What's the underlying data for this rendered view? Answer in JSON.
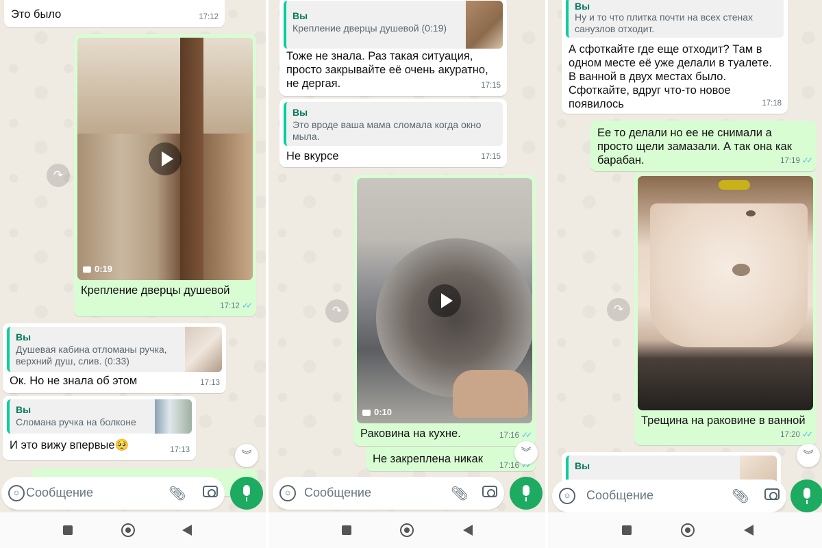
{
  "colors": {
    "chat_bg": "#efeae2",
    "incoming": "#ffffff",
    "outgoing": "#d9fdd3",
    "accent": "#1daa61",
    "quote_name": "#067a5c",
    "read_ticks": "#53bdeb"
  },
  "input_bar": {
    "placeholder": "Сообщение",
    "icons": [
      "sticker-icon",
      "paperclip-icon",
      "camera-icon",
      "microphone-icon"
    ]
  },
  "panel1": {
    "messages": [
      {
        "type": "text",
        "direction": "in",
        "text": "Это было",
        "time": "17:12"
      },
      {
        "type": "video",
        "direction": "out",
        "duration": "0:19",
        "caption": "Крепление дверцы душевой",
        "time": "17:12",
        "read": true
      },
      {
        "type": "reply",
        "direction": "in",
        "quote_name": "Вы",
        "quote_text": "Душевая кабина отломаны ручка, верхний душ, слив. (0:33)",
        "text": "Ок. Но не знала об этом",
        "time": "17:13"
      },
      {
        "type": "reply",
        "direction": "in",
        "quote_name": "Вы",
        "quote_text": "Сломана ручка на болконе",
        "text": "И это вижу впервые🥺",
        "time": "17:13"
      }
    ]
  },
  "panel2": {
    "messages": [
      {
        "type": "reply",
        "direction": "in",
        "quote_name": "Вы",
        "quote_text": "Крепление дверцы душевой (0:19)",
        "text": "Тоже не знала. Раз такая ситуация, просто закрывайте её очень акуратно, не дергая.",
        "time": "17:15"
      },
      {
        "type": "reply",
        "direction": "in",
        "quote_name": "Вы",
        "quote_text": "Это вроде ваша мама сломала когда окно мыла.",
        "text": "Не вкурсе",
        "time": "17:15"
      },
      {
        "type": "video",
        "direction": "out",
        "duration": "0:10",
        "caption": "Раковина на кухне.",
        "time": "17:16",
        "read": true
      },
      {
        "type": "text",
        "direction": "out",
        "text": "Не закреплена никак",
        "time": "17:16",
        "read": true
      }
    ]
  },
  "panel3": {
    "messages": [
      {
        "type": "reply",
        "direction": "in",
        "quote_name": "Вы",
        "quote_text": "Ну и то что плитка почти на всех стенах санузлов отходит.",
        "text": "А сфоткайте где еще отходит? Там в одном месте её уже делали в туалете. В ванной в двух местах было. Сфоткайте, вдруг что-то новое появилось",
        "time": "17:18"
      },
      {
        "type": "text",
        "direction": "out",
        "text": "Ее то делали но ее не снимали а просто щели замазали. А так она как барабан.",
        "time": "17:19",
        "read": true
      },
      {
        "type": "photo",
        "direction": "out",
        "caption": "Трещина на раковине в ванной",
        "time": "17:20",
        "read": true
      },
      {
        "type": "reply-partial",
        "direction": "in",
        "quote_name": "Вы"
      }
    ]
  }
}
